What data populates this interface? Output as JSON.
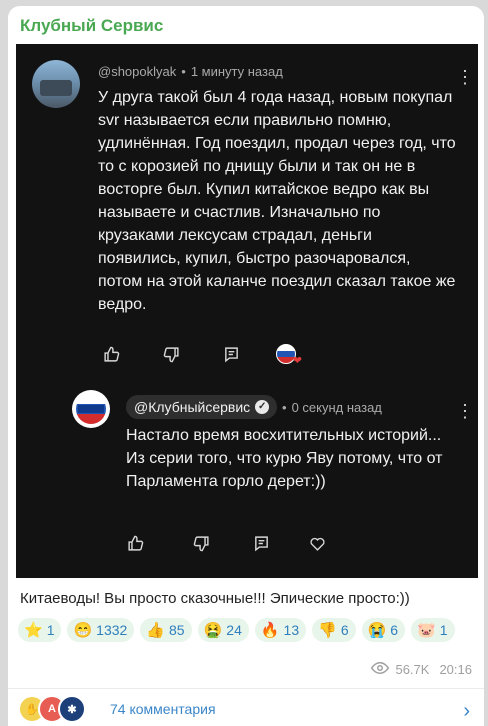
{
  "channel": {
    "title": "Клубный Сервис"
  },
  "comment1": {
    "author": "@shopoklyak",
    "time": "1 минуту назад",
    "text": "У друга такой был 4 года назад, новым покупал svr называется если правильно помню, удлинённая. Год поездил, продал через год, что то с корозией по днищу были и так он не в восторге был. Купил китайское ведро как вы называете и счастлив. Изначально по крузаками лексусам страдал, деньги появились, купил, быстро разочаровался, потом на этой каланче поездил сказал такое же ведро."
  },
  "reply": {
    "author": "@Клубныйсервис",
    "time": "0 секунд назад",
    "text": "Настало время восхитительных историй... Из серии того, что курю Яву потому, что от Парламента горло дерет:))"
  },
  "post": {
    "caption": "Китаеводы! Вы просто сказочные!!! Эпические просто:))",
    "reactions": [
      {
        "emoji": "⭐",
        "count": "1"
      },
      {
        "emoji": "😁",
        "count": "1332"
      },
      {
        "emoji": "👍",
        "count": "85"
      },
      {
        "emoji": "🤮",
        "count": "24"
      },
      {
        "emoji": "🔥",
        "count": "13"
      },
      {
        "emoji": "👎",
        "count": "6"
      },
      {
        "emoji": "😭",
        "count": "6"
      },
      {
        "emoji": "🐷",
        "count": "1"
      }
    ],
    "views": "56.7K",
    "time": "20:16",
    "comments_label": "74 комментария"
  },
  "icons": {
    "like": "thumbs-up-icon",
    "dislike": "thumbs-down-icon",
    "reply": "reply-icon",
    "heart": "heart-icon",
    "more": "kebab-icon",
    "views": "eye-icon",
    "chevron": "chevron-right-icon"
  },
  "colors": {
    "accent_green": "#4aa852",
    "link_blue": "#3b86c8",
    "reaction_bg": "#e8f5ea",
    "dark_bg": "#121212"
  }
}
